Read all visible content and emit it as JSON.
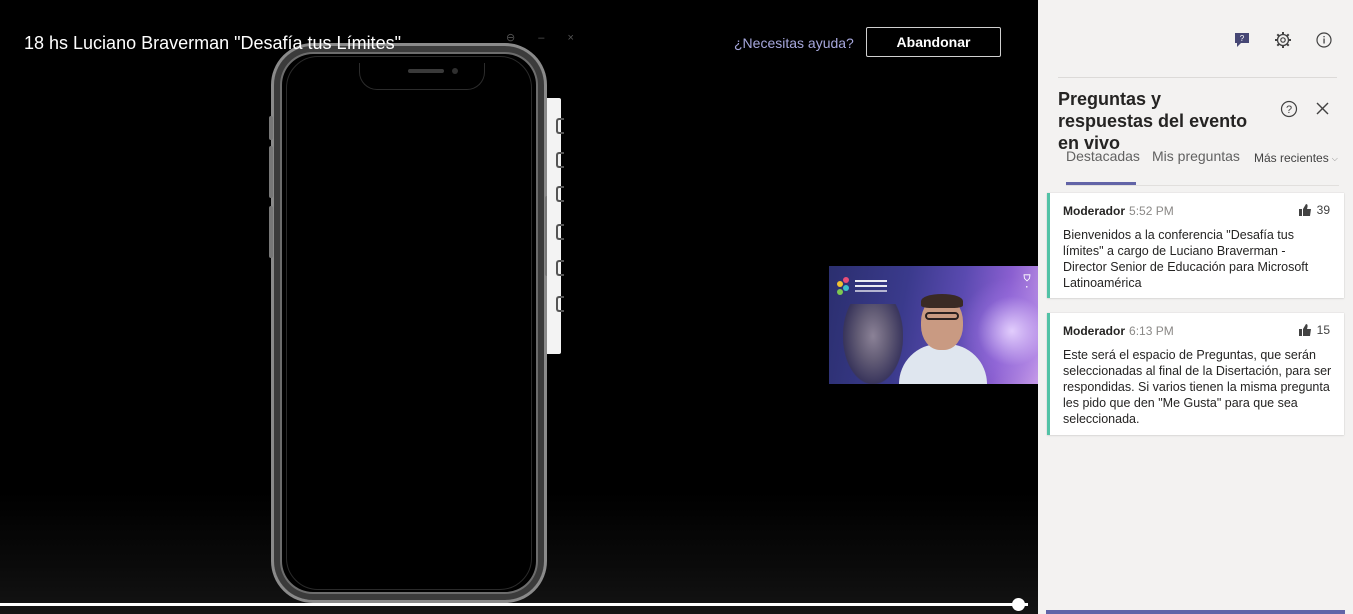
{
  "event": {
    "title": "18 hs Luciano Braverman \"Desafía tus Límites\"",
    "help_link": "¿Necesitas ayuda?",
    "leave_button": "Abandonar"
  },
  "player": {
    "progress_fraction": 0.99
  },
  "panel": {
    "top_icons": [
      "qa-chat-icon",
      "gear-icon",
      "info-icon"
    ],
    "title": "Preguntas y respuestas del evento en vivo",
    "tabs": [
      {
        "label": "Destacadas",
        "selected": true
      },
      {
        "label": "Mis preguntas",
        "selected": false
      }
    ],
    "sort_label": "Más recientes",
    "posts": [
      {
        "author": "Moderador",
        "time": "5:52 PM",
        "likes": "39",
        "text": "Bienvenidos a la conferencia \"Desafía tus límites\" a cargo de Luciano Braverman - Director Senior de Educación para Microsoft Latinoamérica"
      },
      {
        "author": "Moderador",
        "time": "6:13 PM",
        "likes": "15",
        "text": "Este será el espacio de Preguntas, que serán seleccionadas al final de la Disertación, para ser respondidas. Si varios tienen la misma pregunta les pido que den \"Me Gusta\" para que sea seleccionada."
      }
    ]
  },
  "colors": {
    "accent": "#6264a7",
    "card_border": "#52c2a6",
    "panel_bg": "#f3f2f1",
    "help_link": "#a6a7dc"
  }
}
